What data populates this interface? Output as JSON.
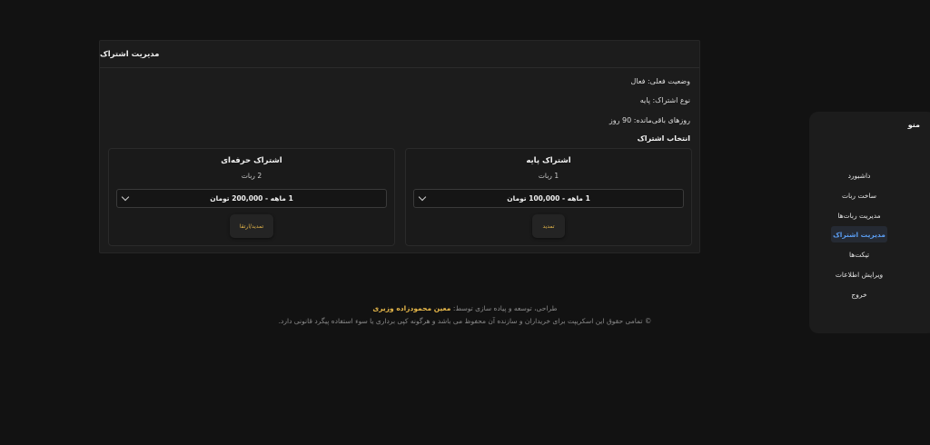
{
  "panel": {
    "title": "مدیریت اشتراک",
    "status": "وضعیت فعلی: فعال",
    "type": "نوع اشتراک: پایه",
    "days": "روزهای باقی‌مانده: 90 روز",
    "select_title": "انتخاب اشتراک"
  },
  "plans": [
    {
      "name": "اشتراک پایه",
      "bots": "1 ربات",
      "option": "1 ماهه - 100,000 تومان",
      "button": "تمدید"
    },
    {
      "name": "اشتراک حرفه‌ای",
      "bots": "2 ربات",
      "option": "1 ماهه - 200,000 تومان",
      "button": "تمدید/ارتقا"
    }
  ],
  "sidebar": {
    "title": "منو",
    "items": [
      {
        "label": "داشبورد"
      },
      {
        "label": "ساخت ربات"
      },
      {
        "label": "مدیریت ربات‌ها"
      },
      {
        "label": "مدیریت اشتراک"
      },
      {
        "label": "تیکت‌ها"
      },
      {
        "label": "ویرایش اطلاعات"
      },
      {
        "label": "خروج"
      }
    ],
    "active_index": 3
  },
  "footer": {
    "credit_prefix": "طراحی، توسعه و پیاده سازی توسط:",
    "author": "معین محمودزاده وزیری",
    "copyright": "© تمامی حقوق این اسکریپت برای خریداران و سازنده آن محفوظ می باشد و هرگونه کپی برداری یا سوء استفاده پیگرد قانونی دارد."
  },
  "colors": {
    "accent": "#e7b84a",
    "active": "#5a9cf0",
    "background": "#121212",
    "panel": "#1c1c1c"
  }
}
